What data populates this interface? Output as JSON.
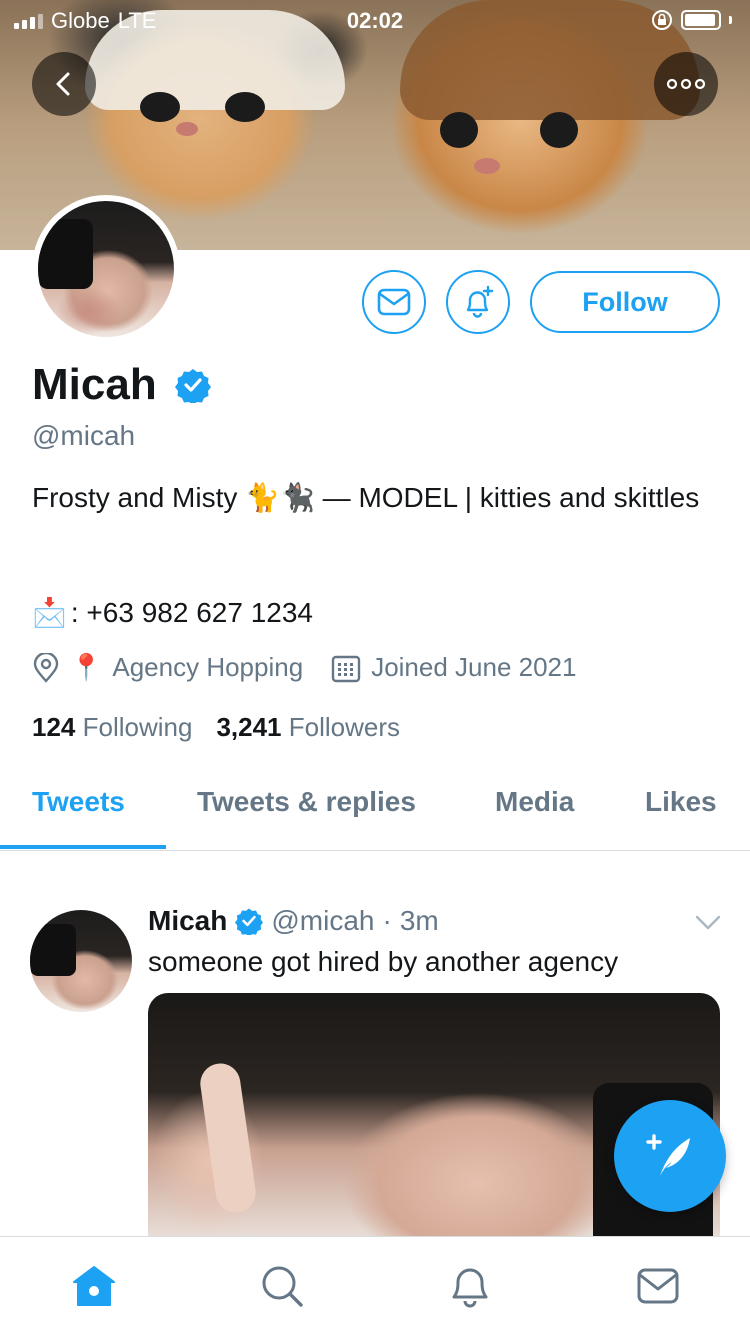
{
  "status_bar": {
    "carrier": "Globe",
    "network": "LTE",
    "time": "02:02"
  },
  "header": {
    "back_icon": "chevron-left-icon",
    "more_icon": "more-icon"
  },
  "profile": {
    "name": "Micah",
    "verified_icon": "verified-badge-icon",
    "handle": "@micah",
    "bio": "Frosty and Misty 🐈🐈‍⬛ — MODEL | kitties and skittles",
    "contact_emoji": "📩",
    "contact": ": +63 982 627 1234",
    "location_emoji": "📍",
    "location": "Agency Hopping",
    "joined": "Joined June 2021",
    "following_count": "124",
    "following_label": "Following",
    "followers_count": "3,241",
    "followers_label": "Followers",
    "follow_label": "Follow"
  },
  "tabs": [
    {
      "label": "Tweets",
      "active": true
    },
    {
      "label": "Tweets & replies",
      "active": false
    },
    {
      "label": "Media",
      "active": false
    },
    {
      "label": "Likes",
      "active": false
    }
  ],
  "tweet": {
    "name": "Micah",
    "handle": "@micah",
    "dot": "·",
    "time": "3m",
    "text": "someone got hired by another agency"
  },
  "colors": {
    "accent": "#1da1f2",
    "secondary_text": "#657786",
    "primary_text": "#14171a"
  },
  "bottom_nav": [
    "home-icon",
    "search-icon",
    "notifications-icon",
    "messages-icon"
  ]
}
